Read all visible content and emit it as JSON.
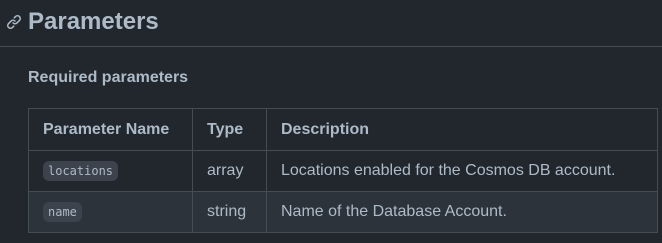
{
  "page": {
    "title": "Parameters",
    "anchor_icon": "link-icon"
  },
  "section": {
    "title": "Required parameters"
  },
  "table": {
    "headers": [
      "Parameter Name",
      "Type",
      "Description"
    ],
    "rows": [
      {
        "name": "locations",
        "type": "array",
        "description": "Locations enabled for the Cosmos DB account."
      },
      {
        "name": "name",
        "type": "string",
        "description": "Name of the Database Account."
      }
    ]
  },
  "colors": {
    "background": "#22272e",
    "alt_row": "#2d333b",
    "border": "#444c56",
    "text": "#adbac7",
    "code_bg": "#3c434d"
  }
}
